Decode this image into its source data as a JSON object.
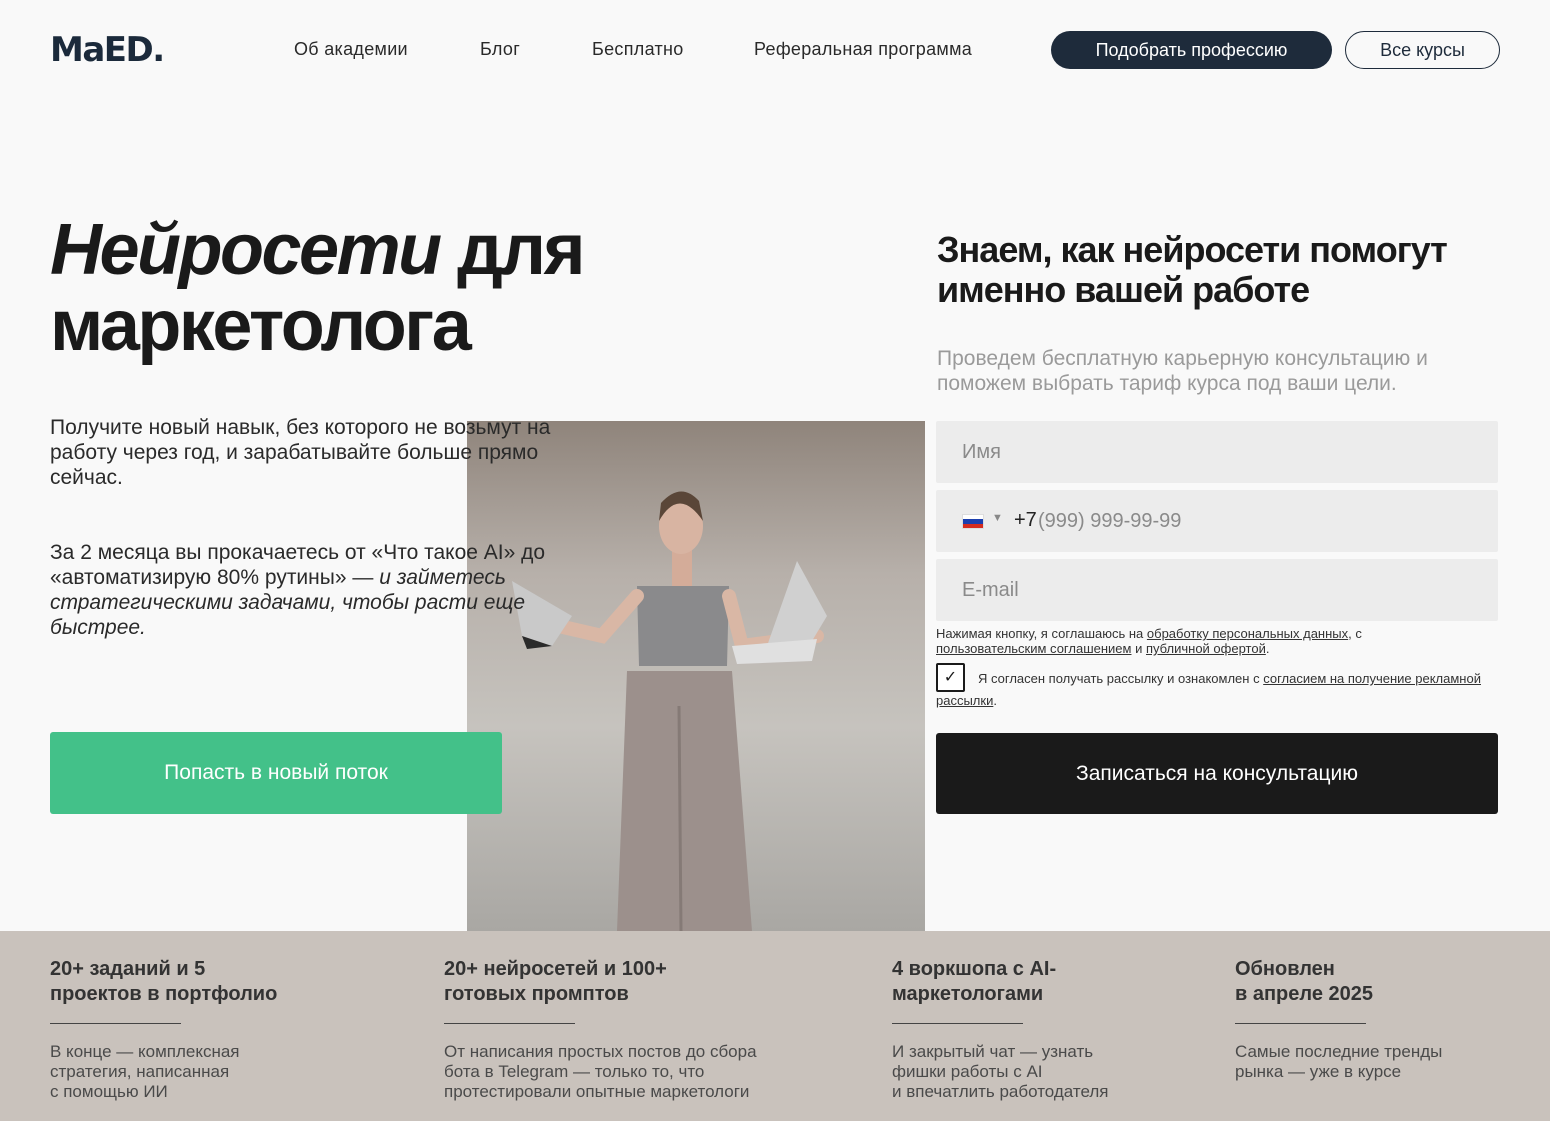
{
  "header": {
    "logo": "MaED.",
    "nav": [
      "Об академии",
      "Блог",
      "Бесплатно",
      "Реферальная программа"
    ],
    "pick_profession": "Подобрать профессию",
    "all_courses": "Все курсы"
  },
  "hero": {
    "title_italic": "Нейросети",
    "title_rest_1": " для",
    "title_rest_2": "маркетолога",
    "lead": "Получите новый навык, без которого не возьмут на работу через год, и зарабатывайте больше прямо сейчас.",
    "lead2_plain": "За 2 месяца вы прокачаетесь от «Что такое AI» до «автоматизирую 80% рутины» — ",
    "lead2_italic": "и займетесь стратегическими задачами, чтобы расти еще быстрее.",
    "cta": "Попасть в новый поток"
  },
  "form": {
    "title": "Знаем, как нейросети помогут именно вашей работе",
    "subtitle": "Проведем бесплатную карьерную консультацию и поможем выбрать тариф курса под ваши цели.",
    "name_placeholder": "Имя",
    "phone_code": "+7",
    "phone_placeholder": "(999) 999-99-99",
    "email_placeholder": "E-mail",
    "consent_prefix": "Нажимая кнопку, я соглашаюсь на ",
    "consent_link1": "обработку персональных данных",
    "consent_mid": ", с ",
    "consent_link2": "пользовательским соглашением",
    "consent_and": " и ",
    "consent_link3": "публичной офертой",
    "consent_end": ".",
    "checkbox_mark": "✓",
    "newsletter_prefix": "Я согласен получать рассылку и ознакомлен с ",
    "newsletter_link": "согласием на получение рекламной рассылки",
    "newsletter_end": ".",
    "submit": "Записаться на консультацию"
  },
  "features": [
    {
      "title": "20+ заданий и 5\nпроектов в портфолио",
      "text": "В конце — комплексная\nстратегия, написанная\nс помощью ИИ"
    },
    {
      "title": "20+ нейросетей и 100+\nготовых промптов",
      "text": "От написания простых постов до сбора\nбота в Telegram — только то, что\nпротестировали опытные маркетологи"
    },
    {
      "title": "4 воркшопа с AI-\nмаркетологами",
      "text": "И закрытый чат — узнать\nфишки работы с AI\nи впечатлить работодателя"
    },
    {
      "title": "Обновлен\nв апреле 2025",
      "text": "Самые последние тренды\nрынка — уже в курсе"
    }
  ],
  "colors": {
    "brand_dark": "#1e2b3b",
    "cta_green": "#43c189",
    "submit_black": "#1a1a1a",
    "features_bg": "#c9c2bc"
  }
}
